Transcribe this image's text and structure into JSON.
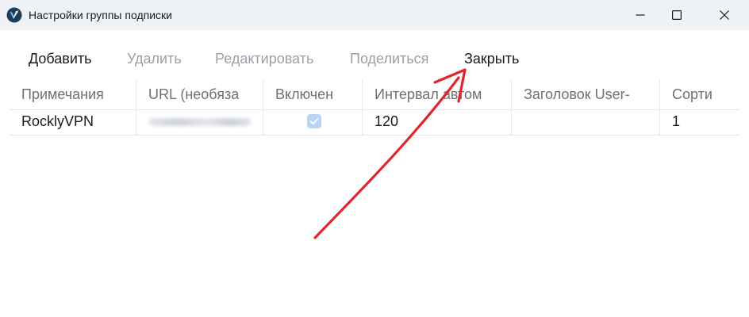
{
  "window": {
    "title": "Настройки группы подписки"
  },
  "toolbar": {
    "add_label": "Добавить",
    "delete_label": "Удалить",
    "edit_label": "Редактировать",
    "share_label": "Поделиться",
    "close_label": "Закрыть"
  },
  "table": {
    "columns": [
      "Примечания",
      "URL (необяза",
      "Включен",
      "Интервал автом",
      "Заголовок User-",
      "Сорти"
    ],
    "rows": [
      {
        "remarks": "RocklyVPN",
        "url": "",
        "enabled": true,
        "interval": "120",
        "user_agent": "",
        "sort": "1"
      }
    ]
  },
  "colors": {
    "titlebar_bg": "#eef1f6",
    "disabled_text": "#9aa0a6",
    "checkbox_fill": "#b9d3f4",
    "annotation_arrow": "#e0252d"
  },
  "icons": {
    "app": "v2rayn-logo-icon",
    "minimize": "minimize-icon",
    "maximize": "maximize-icon",
    "close": "close-icon",
    "check": "checkmark-icon",
    "annotation": "red-arrow-annotation"
  }
}
